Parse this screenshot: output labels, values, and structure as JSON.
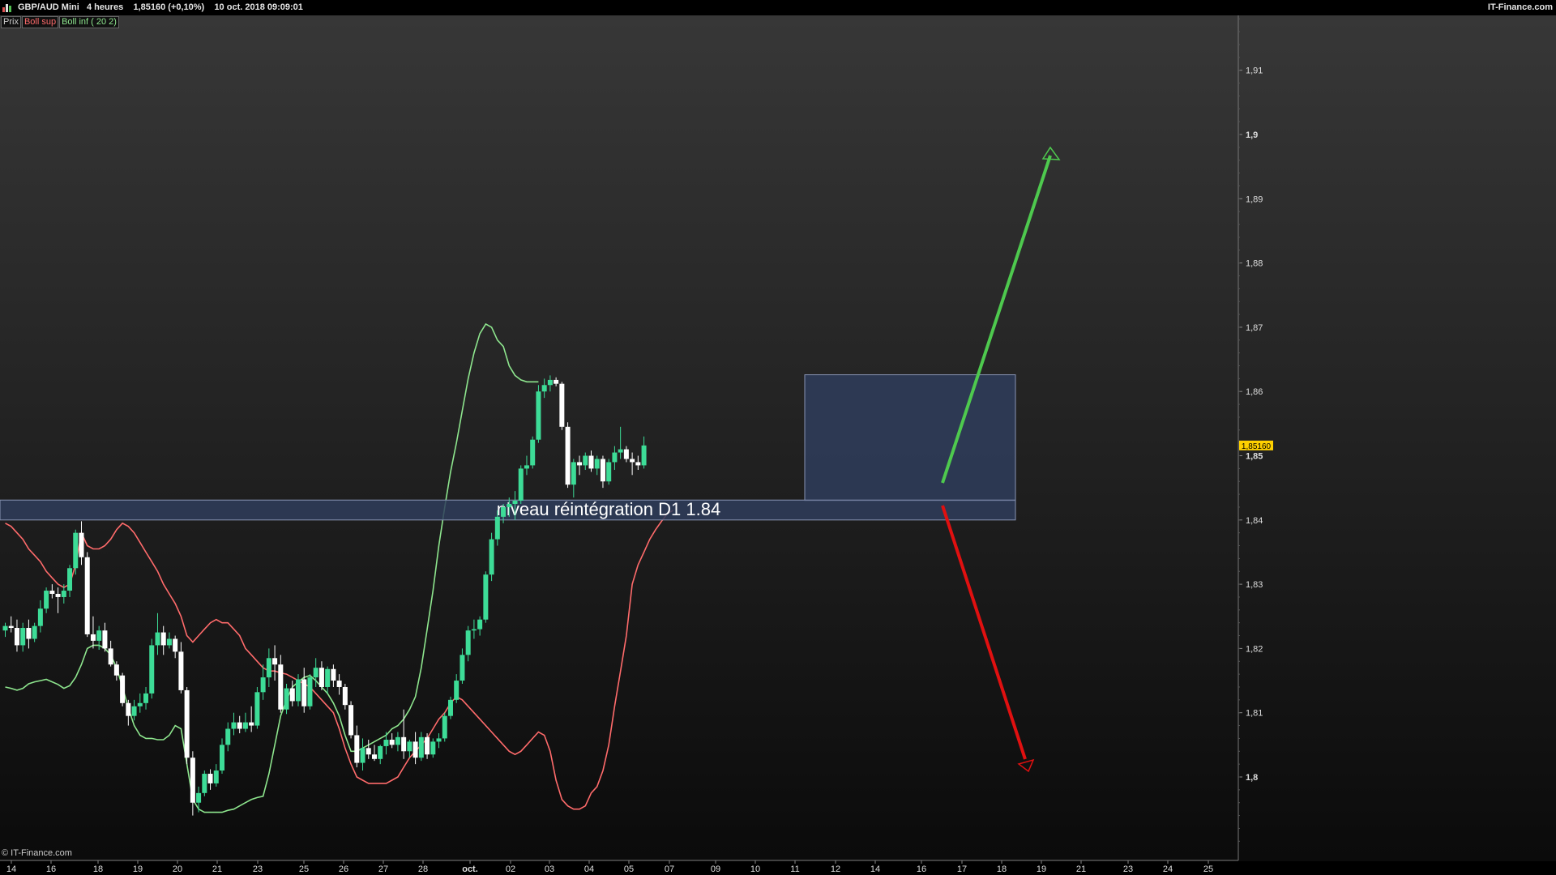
{
  "header": {
    "symbol": "GBP/AUD Mini",
    "timeframe": "4 heures",
    "price_change": "1,85160 (+0,10%)",
    "datetime": "10 oct. 2018 09:09:01",
    "brand": "IT-Finance.com"
  },
  "legend": {
    "price": "Prix",
    "boll_sup": "Boll sup",
    "boll_inf": "Boll inf ( 20 2)"
  },
  "footer": {
    "copyright": "© IT-Finance.com"
  },
  "colors": {
    "bull": "#3ddc97",
    "bear": "#ffffff",
    "boll_sup": "#ff6b6b",
    "boll_inf": "#8ee68e",
    "zone": "#2f3d5c",
    "arrow_up": "#4ec94e",
    "arrow_down": "#e01010",
    "price_tag": "#ffd100"
  },
  "chart_data": {
    "type": "candlestick",
    "ylim": [
      1.789,
      1.922
    ],
    "y_ticks": [
      {
        "value": 1.8,
        "label": "1,8"
      },
      {
        "value": 1.81,
        "label": "1,81"
      },
      {
        "value": 1.82,
        "label": "1,82"
      },
      {
        "value": 1.83,
        "label": "1,83"
      },
      {
        "value": 1.84,
        "label": "1,84"
      },
      {
        "value": 1.85,
        "label": "1,85"
      },
      {
        "value": 1.86,
        "label": "1,86"
      },
      {
        "value": 1.87,
        "label": "1,87"
      },
      {
        "value": 1.88,
        "label": "1,88"
      },
      {
        "value": 1.89,
        "label": "1,89"
      },
      {
        "value": 1.9,
        "label": "1,9"
      },
      {
        "value": 1.91,
        "label": "1,91"
      }
    ],
    "bold_ticks": [
      "1,8",
      "1,85",
      "1,9"
    ],
    "x_labels": [
      "14",
      "16",
      "18",
      "19",
      "20",
      "21",
      "23",
      "25",
      "26",
      "27",
      "28",
      "oct.",
      "02",
      "03",
      "04",
      "05",
      "07",
      "09",
      "10",
      "11",
      "12",
      "14",
      "16",
      "17",
      "18",
      "19",
      "21",
      "23",
      "24",
      "25"
    ],
    "current_price": "1,85160",
    "current_price_value": 1.8516,
    "candles_ohlc": [
      [
        1.8228,
        1.824,
        1.8218,
        1.8235
      ],
      [
        1.8235,
        1.825,
        1.8225,
        1.8232
      ],
      [
        1.8232,
        1.8245,
        1.8195,
        1.8205
      ],
      [
        1.8205,
        1.824,
        1.8195,
        1.8232
      ],
      [
        1.8232,
        1.8245,
        1.82,
        1.8215
      ],
      [
        1.8215,
        1.824,
        1.821,
        1.8235
      ],
      [
        1.8235,
        1.8275,
        1.8225,
        1.8262
      ],
      [
        1.8262,
        1.8295,
        1.8255,
        1.829
      ],
      [
        1.829,
        1.83,
        1.8278,
        1.8285
      ],
      [
        1.8285,
        1.8295,
        1.8255,
        1.828
      ],
      [
        1.828,
        1.83,
        1.827,
        1.829
      ],
      [
        1.829,
        1.833,
        1.828,
        1.8325
      ],
      [
        1.8325,
        1.8385,
        1.8315,
        1.838
      ],
      [
        1.838,
        1.8398,
        1.833,
        1.8342
      ],
      [
        1.8342,
        1.835,
        1.8218,
        1.8222
      ],
      [
        1.8222,
        1.825,
        1.82,
        1.8212
      ],
      [
        1.8212,
        1.8235,
        1.8198,
        1.8228
      ],
      [
        1.8228,
        1.824,
        1.8195,
        1.82
      ],
      [
        1.82,
        1.8212,
        1.8172,
        1.8175
      ],
      [
        1.8175,
        1.818,
        1.815,
        1.8158
      ],
      [
        1.8158,
        1.8162,
        1.811,
        1.8115
      ],
      [
        1.8115,
        1.812,
        1.808,
        1.8095
      ],
      [
        1.8095,
        1.812,
        1.8088,
        1.811
      ],
      [
        1.811,
        1.813,
        1.81,
        1.8115
      ],
      [
        1.8115,
        1.814,
        1.8105,
        1.813
      ],
      [
        1.813,
        1.8215,
        1.8122,
        1.8205
      ],
      [
        1.8205,
        1.8255,
        1.819,
        1.8225
      ],
      [
        1.8225,
        1.8235,
        1.819,
        1.8205
      ],
      [
        1.8205,
        1.8225,
        1.82,
        1.8215
      ],
      [
        1.8215,
        1.822,
        1.8185,
        1.8195
      ],
      [
        1.8195,
        1.821,
        1.813,
        1.8135
      ],
      [
        1.8135,
        1.814,
        1.802,
        1.803
      ],
      [
        1.803,
        1.804,
        1.794,
        1.796
      ],
      [
        1.796,
        1.7985,
        1.7945,
        1.7975
      ],
      [
        1.7975,
        1.801,
        1.797,
        1.8005
      ],
      [
        1.8005,
        1.8012,
        1.798,
        1.799
      ],
      [
        1.799,
        1.802,
        1.7985,
        1.801
      ],
      [
        1.801,
        1.806,
        1.8005,
        1.805
      ],
      [
        1.805,
        1.8085,
        1.804,
        1.8075
      ],
      [
        1.8075,
        1.81,
        1.8065,
        1.8085
      ],
      [
        1.8085,
        1.8095,
        1.8068,
        1.8075
      ],
      [
        1.8075,
        1.81,
        1.807,
        1.8085
      ],
      [
        1.8085,
        1.811,
        1.807,
        1.808
      ],
      [
        1.808,
        1.814,
        1.8075,
        1.8132
      ],
      [
        1.8132,
        1.8175,
        1.812,
        1.8155
      ],
      [
        1.8155,
        1.82,
        1.814,
        1.8185
      ],
      [
        1.8185,
        1.8205,
        1.815,
        1.8175
      ],
      [
        1.8175,
        1.819,
        1.81,
        1.8105
      ],
      [
        1.8105,
        1.8145,
        1.8098,
        1.8138
      ],
      [
        1.8138,
        1.815,
        1.811,
        1.8118
      ],
      [
        1.8118,
        1.816,
        1.811,
        1.8152
      ],
      [
        1.8152,
        1.817,
        1.81,
        1.811
      ],
      [
        1.811,
        1.816,
        1.8105,
        1.8155
      ],
      [
        1.8155,
        1.8185,
        1.814,
        1.817
      ],
      [
        1.817,
        1.818,
        1.8135,
        1.814
      ],
      [
        1.814,
        1.8172,
        1.813,
        1.8168
      ],
      [
        1.8168,
        1.8175,
        1.814,
        1.815
      ],
      [
        1.815,
        1.816,
        1.8128,
        1.814
      ],
      [
        1.814,
        1.8145,
        1.8105,
        1.8112
      ],
      [
        1.8112,
        1.8118,
        1.806,
        1.8065
      ],
      [
        1.8065,
        1.808,
        1.8015,
        1.8022
      ],
      [
        1.8022,
        1.806,
        1.801,
        1.8045
      ],
      [
        1.8045,
        1.8058,
        1.8028,
        1.8035
      ],
      [
        1.8035,
        1.805,
        1.8025,
        1.8028
      ],
      [
        1.8028,
        1.805,
        1.802,
        1.8048
      ],
      [
        1.8048,
        1.807,
        1.8035,
        1.8058
      ],
      [
        1.8058,
        1.8068,
        1.8045,
        1.805
      ],
      [
        1.805,
        1.807,
        1.804,
        1.8062
      ],
      [
        1.8062,
        1.8105,
        1.8028,
        1.804
      ],
      [
        1.804,
        1.8058,
        1.803,
        1.8055
      ],
      [
        1.8055,
        1.807,
        1.802,
        1.803
      ],
      [
        1.803,
        1.807,
        1.8025,
        1.8062
      ],
      [
        1.8062,
        1.8068,
        1.8028,
        1.8035
      ],
      [
        1.8035,
        1.806,
        1.803,
        1.8055
      ],
      [
        1.8055,
        1.8068,
        1.8045,
        1.806
      ],
      [
        1.806,
        1.81,
        1.8055,
        1.8095
      ],
      [
        1.8095,
        1.8125,
        1.809,
        1.812
      ],
      [
        1.812,
        1.816,
        1.8115,
        1.815
      ],
      [
        1.815,
        1.82,
        1.8145,
        1.819
      ],
      [
        1.819,
        1.8235,
        1.818,
        1.8228
      ],
      [
        1.8228,
        1.8245,
        1.8215,
        1.823
      ],
      [
        1.823,
        1.825,
        1.822,
        1.8245
      ],
      [
        1.8245,
        1.832,
        1.824,
        1.8315
      ],
      [
        1.8315,
        1.838,
        1.8305,
        1.837
      ],
      [
        1.837,
        1.8415,
        1.836,
        1.8405
      ],
      [
        1.8405,
        1.8425,
        1.8395,
        1.842
      ],
      [
        1.842,
        1.8435,
        1.8405,
        1.8425
      ],
      [
        1.8425,
        1.8445,
        1.84,
        1.843
      ],
      [
        1.843,
        1.8485,
        1.8425,
        1.848
      ],
      [
        1.848,
        1.85,
        1.847,
        1.8485
      ],
      [
        1.8485,
        1.853,
        1.848,
        1.8525
      ],
      [
        1.8525,
        1.861,
        1.852,
        1.86
      ],
      [
        1.86,
        1.862,
        1.859,
        1.861
      ],
      [
        1.861,
        1.8625,
        1.86,
        1.8618
      ],
      [
        1.8618,
        1.8622,
        1.8608,
        1.8612
      ],
      [
        1.8612,
        1.8615,
        1.854,
        1.8545
      ],
      [
        1.8545,
        1.8552,
        1.845,
        1.8455
      ],
      [
        1.8455,
        1.8495,
        1.8435,
        1.849
      ],
      [
        1.849,
        1.85,
        1.847,
        1.8485
      ],
      [
        1.8485,
        1.8505,
        1.8478,
        1.85
      ],
      [
        1.85,
        1.8508,
        1.8475,
        1.848
      ],
      [
        1.848,
        1.85,
        1.847,
        1.8495
      ],
      [
        1.8495,
        1.85,
        1.845,
        1.846
      ],
      [
        1.846,
        1.8495,
        1.8455,
        1.849
      ],
      [
        1.849,
        1.8515,
        1.8478,
        1.8505
      ],
      [
        1.8505,
        1.8545,
        1.8495,
        1.851
      ],
      [
        1.851,
        1.8515,
        1.849,
        1.8495
      ],
      [
        1.8495,
        1.8505,
        1.847,
        1.849
      ],
      [
        1.849,
        1.85,
        1.8478,
        1.8485
      ],
      [
        1.8485,
        1.853,
        1.848,
        1.8516
      ]
    ],
    "boll_sup": [
      1.8395,
      1.839,
      1.838,
      1.837,
      1.8355,
      1.8345,
      1.8335,
      1.832,
      1.831,
      1.83,
      1.8295,
      1.83,
      1.833,
      1.838,
      1.836,
      1.8355,
      1.8355,
      1.836,
      1.837,
      1.8385,
      1.8395,
      1.839,
      1.838,
      1.8365,
      1.835,
      1.8335,
      1.832,
      1.83,
      1.8285,
      1.827,
      1.825,
      1.822,
      1.821,
      1.822,
      1.823,
      1.824,
      1.8245,
      1.824,
      1.824,
      1.823,
      1.822,
      1.82,
      1.819,
      1.818,
      1.817,
      1.8165,
      1.8165,
      1.8162,
      1.816,
      1.8155,
      1.815,
      1.8145,
      1.814,
      1.813,
      1.812,
      1.811,
      1.81,
      1.8075,
      1.8045,
      1.802,
      1.8,
      1.7995,
      1.799,
      1.799,
      1.799,
      1.799,
      1.7995,
      1.8,
      1.8015,
      1.803,
      1.804,
      1.805,
      1.806,
      1.8075,
      1.809,
      1.81,
      1.8115,
      1.8125,
      1.812,
      1.811,
      1.81,
      1.809,
      1.808,
      1.807,
      1.806,
      1.805,
      1.804,
      1.8035,
      1.804,
      1.805,
      1.806,
      1.807,
      1.8065,
      1.804,
      1.7995,
      1.7965,
      1.7955,
      1.795,
      1.795,
      1.7955,
      1.7975,
      1.7985,
      1.801,
      1.805,
      1.811,
      1.8165,
      1.822,
      1.83,
      1.833,
      1.835,
      1.837,
      1.8385,
      1.8398,
      1.841,
      1.8415
    ],
    "boll_inf": [
      1.814,
      1.8138,
      1.8135,
      1.8138,
      1.8145,
      1.8148,
      1.815,
      1.8152,
      1.8148,
      1.8144,
      1.8138,
      1.8142,
      1.8155,
      1.8175,
      1.82,
      1.8205,
      1.8205,
      1.82,
      1.819,
      1.817,
      1.814,
      1.8108,
      1.808,
      1.8065,
      1.806,
      1.806,
      1.8058,
      1.8058,
      1.8065,
      1.808,
      1.8075,
      1.802,
      1.7965,
      1.795,
      1.7945,
      1.7945,
      1.7945,
      1.7945,
      1.7948,
      1.795,
      1.7955,
      1.796,
      1.7965,
      1.7968,
      1.797,
      1.8005,
      1.805,
      1.8095,
      1.812,
      1.814,
      1.8148,
      1.8155,
      1.8158,
      1.815,
      1.814,
      1.813,
      1.8115,
      1.8095,
      1.8065,
      1.804,
      1.804,
      1.8045,
      1.805,
      1.8055,
      1.806,
      1.8065,
      1.8075,
      1.808,
      1.809,
      1.8105,
      1.8125,
      1.817,
      1.823,
      1.829,
      1.836,
      1.842,
      1.8475,
      1.852,
      1.857,
      1.862,
      1.866,
      1.869,
      1.8705,
      1.87,
      1.868,
      1.867,
      1.864,
      1.8625,
      1.8618,
      1.8615,
      1.8615,
      1.8615
    ]
  },
  "annotations": {
    "zone_label": "niveau réintégration D1 1.84"
  }
}
